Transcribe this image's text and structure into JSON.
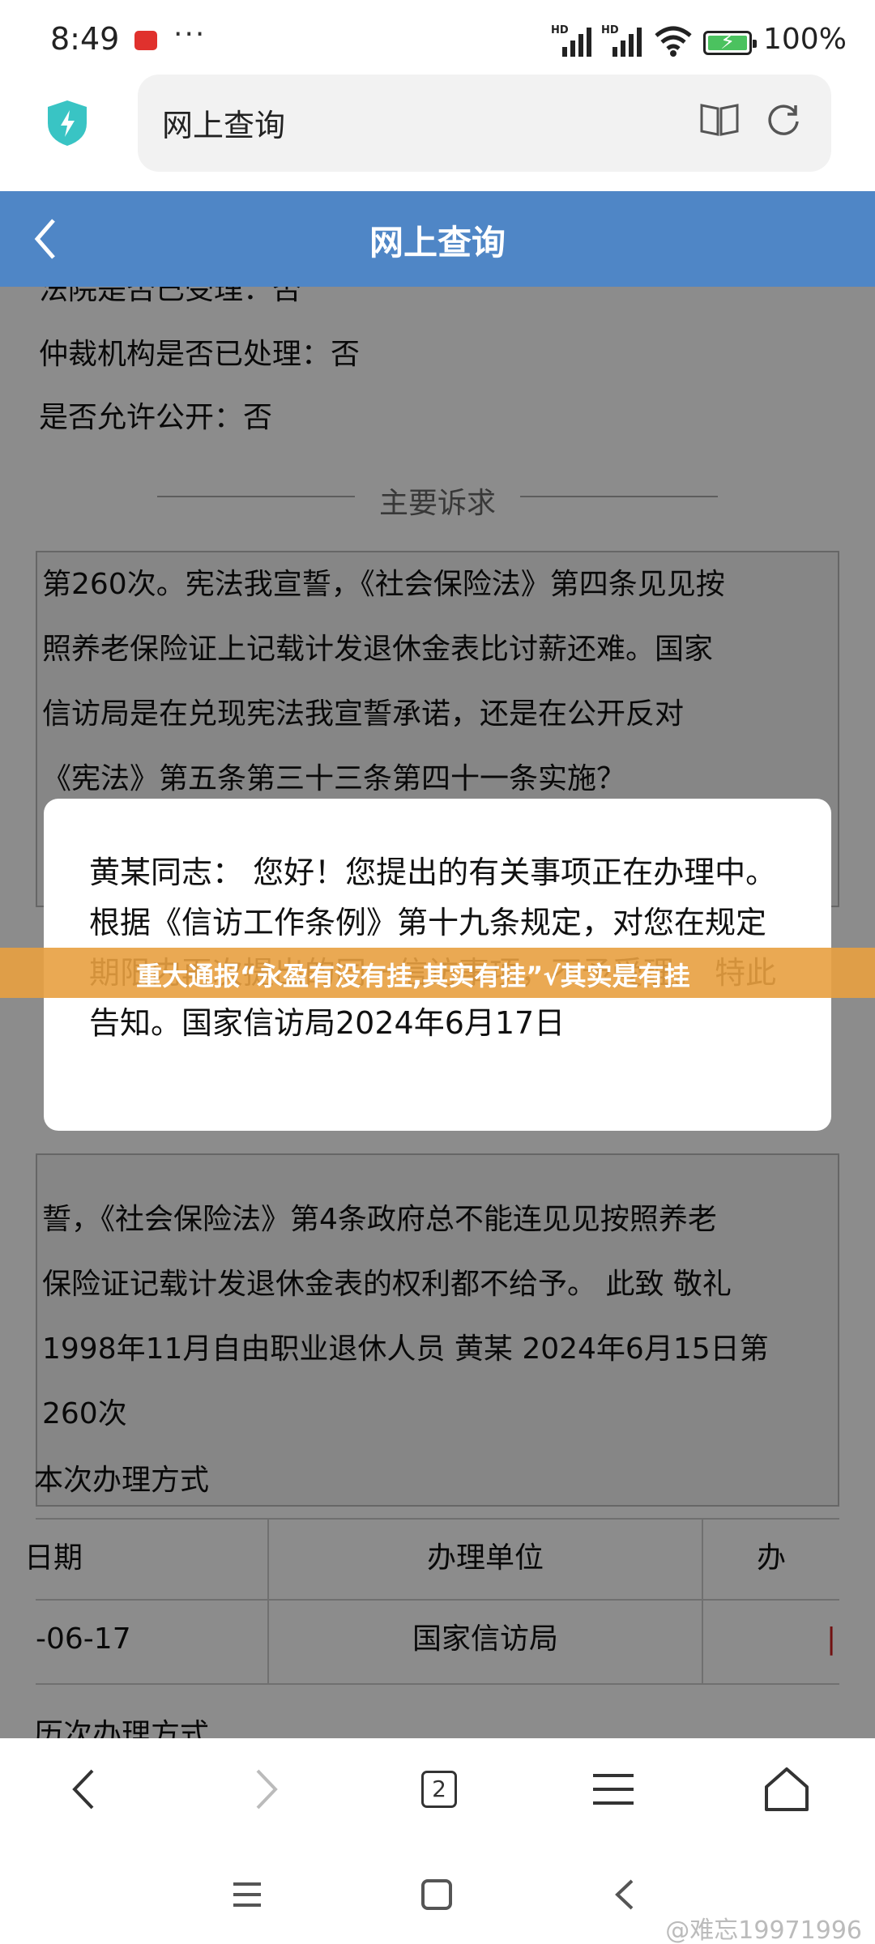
{
  "status_bar": {
    "time": "8:49",
    "dots": "···",
    "signal_1": "HD",
    "signal_2": "HD",
    "battery": "100%"
  },
  "browser": {
    "url_text": "网上查询",
    "tab_count": "2",
    "icons": [
      "shield-icon",
      "reader-icon",
      "reload-icon"
    ]
  },
  "header": {
    "title": "网上查询"
  },
  "details": {
    "court_accepted": "法院是否已受理：否",
    "arbitration": "仲裁机构是否已处理：否",
    "public": "是否允许公开：否"
  },
  "section_main": {
    "title": "主要诉求",
    "body_top": [
      "第260次。宪法我宣誓，《社会保险法》第四条见见按",
      "照养老保险证上记载计发退休金表比讨薪还难。国家",
      "信访局是在兑现宪法我宣誓承诺，还是在公开反对",
      "《宪法》第五条第三十三条第四十一条实施？"
    ],
    "body_bottom": [
      "誓，《社会保险法》第4条政府总不能连见见按照养老",
      "保险证记载计发退休金表的权利都不给予。 此致 敬礼",
      "1998年11月自由职业退休人员 黄某 2024年6月15日第",
      "260次"
    ]
  },
  "dialog": {
    "message": "黄某同志： 您好！您提出的有关事项正在办理中。根据《信访工作条例》第十九条规定，对您在规定期限内再次提出的同一信访事项，不予受理。 特此告知。国家信访局2024年6月17日"
  },
  "banner": {
    "text": "重大通报“永盈有没有挂,其实有挂”√其实是有挂"
  },
  "handling": {
    "title": "本次办理方式",
    "columns": [
      "日期",
      "办理单位",
      "办"
    ],
    "rows": [
      {
        "date": "-06-17",
        "unit": "国家信访局",
        "extra": "|"
      }
    ],
    "history_title": "历次办理方式"
  },
  "system": {
    "signature": "@难忘19971996"
  },
  "colors": {
    "header_blue": "#4f86c6",
    "banner_orange": "#e8a040",
    "shield_teal": "#39c4c4"
  }
}
